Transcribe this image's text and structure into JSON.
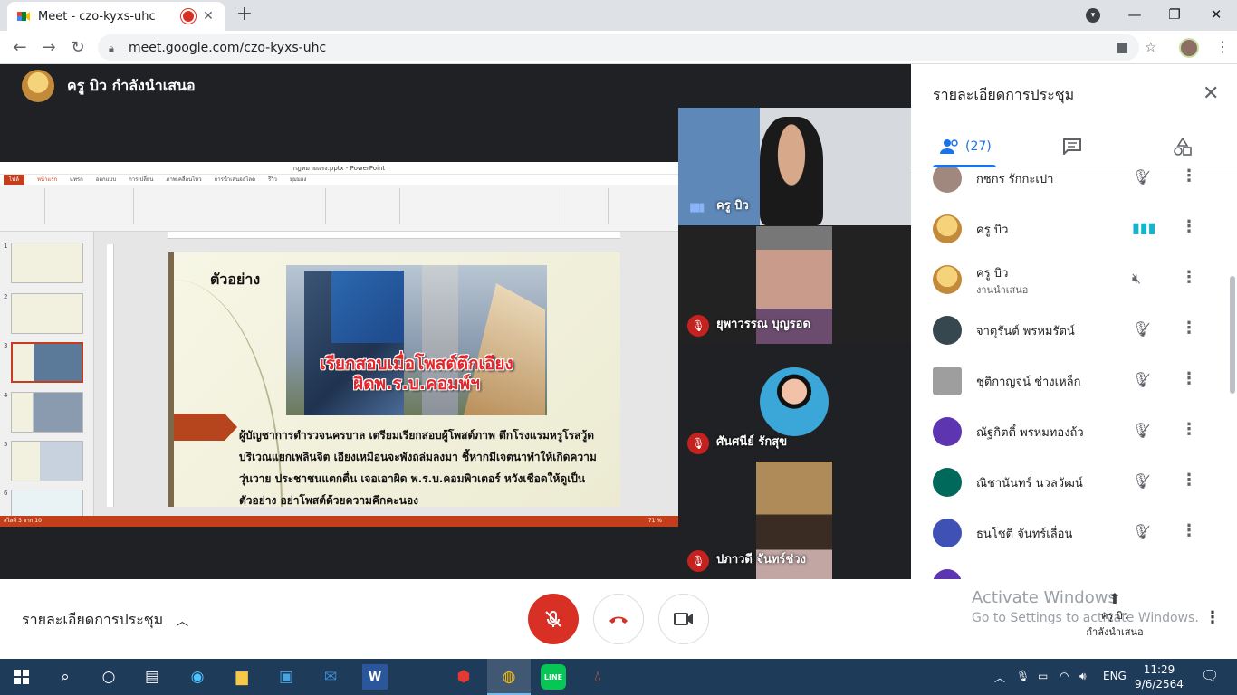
{
  "browser": {
    "tab_title": "Meet - czo-kyxs-uhc",
    "url": "meet.google.com/czo-kyxs-uhc"
  },
  "presenter": {
    "label": "ครู บิว กำลังนำเสนอ"
  },
  "ppt": {
    "window_title": "กฎหมายแรง.pptx - PowerPoint",
    "menu": [
      "ไฟล์",
      "หน้าแรก",
      "แทรก",
      "ออกแบบ",
      "การเปลี่ยน",
      "ภาพเคลื่อนไหว",
      "การนำเสนอสไลด์",
      "รีวิว",
      "มุมมอง"
    ],
    "thumb_numbers": [
      "1",
      "2",
      "3",
      "4",
      "5",
      "6"
    ],
    "status": "สไลด์ 3 จาก 10",
    "zoom": "71 %",
    "slide": {
      "title": "ตัวอย่าง",
      "headline_1": "เรียกสอบเมื่อโพสต์ตึกเอียง",
      "headline_2": "ผิดพ.ร.บ.คอมพ์ฯ",
      "body": "ผู้บัญชาการตำรวจนครบาล เตรียมเรียกสอบผู้โพสต์ภาพ ตึกโรงแรมหรูโรสวู้ด บริเวณแยกเพลินจิต เอียงเหมือนจะพังถล่มลงมา ชี้หากมีเจตนาทำให้เกิดความวุ่นวาย ประชาชนแตกตื่น เจอเอาผิด พ.ร.บ.คอมพิวเตอร์ หวังเชือดให้ดูเป็นตัวอย่าง อย่าโพสต์ด้วยความคึกคะนอง"
    }
  },
  "tiles": [
    {
      "name": "ครู บิว",
      "muted": false
    },
    {
      "name": "ยุพาวรรณ บุญรอด",
      "muted": true
    },
    {
      "name": "ศันศนีย์ รักสุข",
      "muted": true
    },
    {
      "name": "ปภาวดี จันทร์ช่วง",
      "muted": true
    }
  ],
  "panel": {
    "title": "รายละเอียดการประชุม",
    "people_count": "(27)",
    "participants": [
      {
        "name": "กชกร รักกะเปา",
        "sub": "",
        "state": "muted",
        "color": "#a1887f"
      },
      {
        "name": "ครู บิว",
        "sub": "",
        "state": "speaking",
        "color": "#e6c070"
      },
      {
        "name": "ครู บิว",
        "sub": "งานนำเสนอ",
        "state": "presenting",
        "color": "#e6c070"
      },
      {
        "name": "จาตุรันต์ พรหมรัตน์",
        "sub": "",
        "state": "muted",
        "color": "#37474f"
      },
      {
        "name": "ชุติกาญจน์ ช่างเหล็ก",
        "sub": "",
        "state": "muted",
        "color": "#9e9e9e"
      },
      {
        "name": "ณัฐกิตติ์ พรหมทองถ้ว",
        "sub": "",
        "state": "muted",
        "color": "#5e35b1"
      },
      {
        "name": "ณิชานันทร์ นวลวัฒน์",
        "sub": "",
        "state": "muted",
        "color": "#00695c"
      },
      {
        "name": "ธนโชติ จันทร์เลื่อน",
        "sub": "",
        "state": "muted",
        "color": "#3f51b5"
      }
    ]
  },
  "bottom": {
    "meeting_details": "รายละเอียดการประชุม",
    "activate_1": "Activate Windows",
    "activate_2": "Go to Settings to activate Windows.",
    "presenter_name": "ครู บิว",
    "presenter_status": "กำลังนำเสนอ"
  },
  "taskbar": {
    "lang": "ENG",
    "time": "11:29",
    "date": "9/6/2564"
  },
  "colors": {
    "meet_red": "#d93025",
    "meet_blue": "#1a73e8",
    "ppt_orange": "#c43e1c"
  }
}
